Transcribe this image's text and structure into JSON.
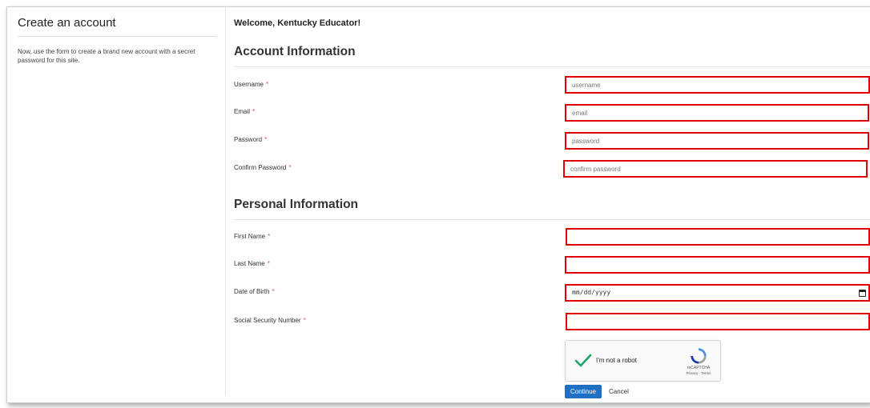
{
  "sidebar": {
    "title": "Create an account",
    "description": "Now, use the form to create a brand new account with a secret password for this site."
  },
  "main": {
    "welcome": "Welcome, Kentucky Educator!",
    "account_section": {
      "heading": "Account Information",
      "fields": {
        "username": {
          "label": "Username",
          "placeholder": "username"
        },
        "email": {
          "label": "Email",
          "placeholder": "email"
        },
        "password": {
          "label": "Password",
          "placeholder": "password"
        },
        "confirm_password": {
          "label": "Confirm Password",
          "placeholder": "confirm password"
        }
      }
    },
    "personal_section": {
      "heading": "Personal Information",
      "fields": {
        "first_name": {
          "label": "First Name"
        },
        "last_name": {
          "label": "Last Name"
        },
        "dob": {
          "label": "Date of Birth",
          "placeholder": "mm/dd/yyyy"
        },
        "ssn": {
          "label": "Social Security Number"
        }
      }
    },
    "required_marker": "*",
    "captcha": {
      "label": "I'm not a robot",
      "brand": "reCAPTCHA",
      "links": "Privacy - Terms"
    },
    "buttons": {
      "continue": "Continue",
      "cancel": "Cancel"
    }
  },
  "colors": {
    "highlight_border": "#e00000",
    "required": "#d9534f",
    "primary_button": "#1f6fc5"
  },
  "icons": [
    "calendar-icon",
    "checkmark-icon",
    "recaptcha-logo-icon"
  ]
}
